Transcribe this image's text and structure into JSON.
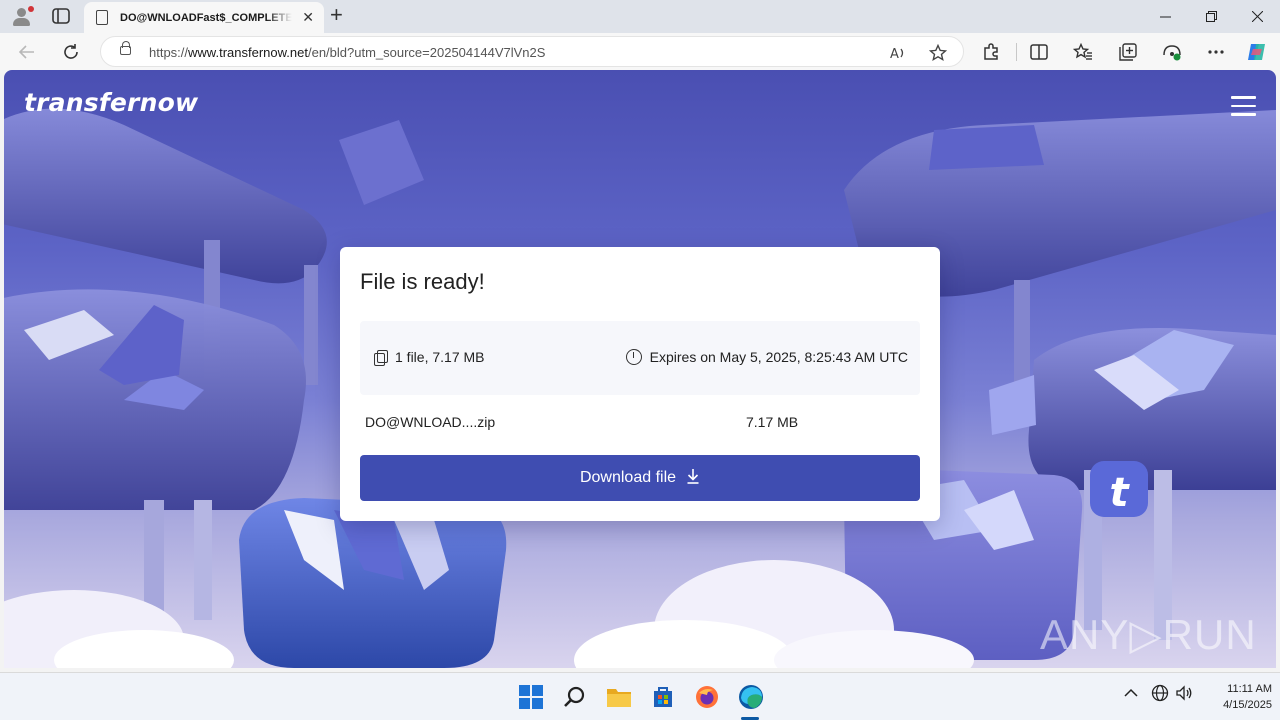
{
  "browser": {
    "tab_title": "DO@WNLOADFast$_COMPLETED",
    "url_prefix": "https://",
    "url_host": "www.transfernow.net",
    "url_path": "/en/bld?utm_source=202504144V7lVn2S",
    "new_tab_symbol": "+",
    "close_tab_symbol": "✕"
  },
  "page": {
    "brand": "transfernow",
    "card": {
      "heading": "File is ready!",
      "file_summary": "1 file, 7.17 MB",
      "expires": "Expires on May 5, 2025, 8:25:43 AM UTC",
      "file_name": "DO@WNLOAD....zip",
      "file_size": "7.17 MB",
      "download_label": "Download file",
      "download_arrow": "⤓"
    },
    "watermark": "ANY▷RUN"
  },
  "taskbar": {
    "time": "11:11 AM",
    "date": "4/15/2025",
    "tray_chevron": "^"
  },
  "colors": {
    "accent": "#3f4db1",
    "background_top": "#4a4fb2",
    "edge_blue": "#0c59a4"
  },
  "icons": [
    "profile-icon",
    "tab-actions-icon",
    "page-icon",
    "back-icon",
    "refresh-icon",
    "lock-icon",
    "read-aloud-icon",
    "favorite-icon",
    "extensions-icon",
    "split-screen-icon",
    "favorites-icon",
    "collections-icon",
    "performance-icon",
    "more-icon",
    "copilot-icon",
    "copy-icon",
    "clock-icon",
    "download-icon",
    "windows-start-icon",
    "search-icon",
    "file-explorer-icon",
    "store-icon",
    "firefox-icon",
    "edge-icon",
    "network-icon",
    "volume-icon"
  ]
}
